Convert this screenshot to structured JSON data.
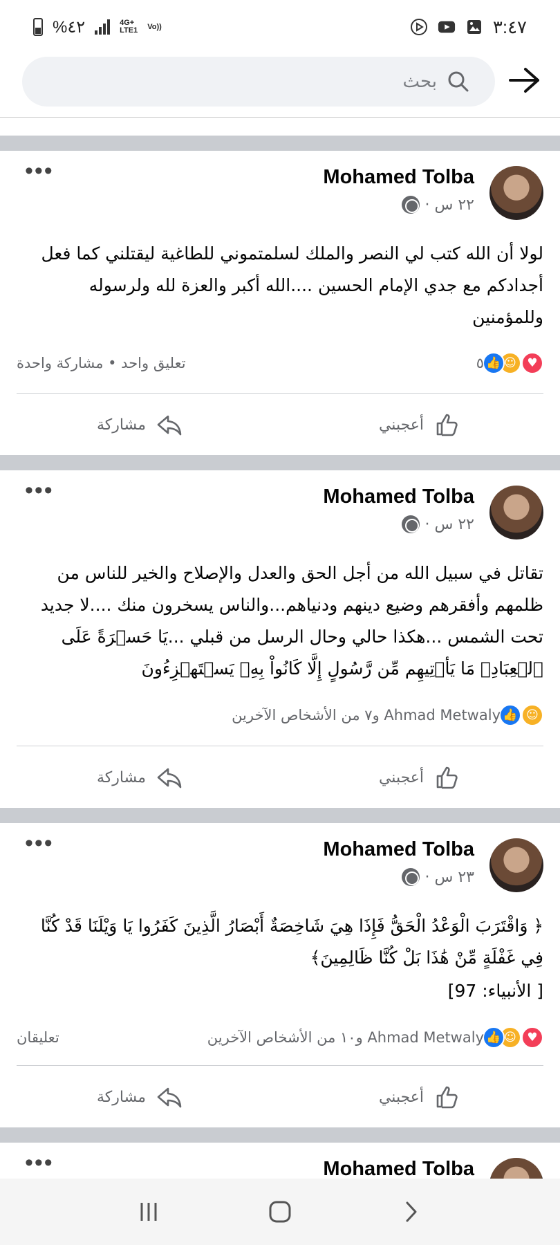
{
  "status_bar": {
    "time": "٣:٤٧",
    "battery": "%٤٢",
    "network_top": "4G+",
    "network_bottom": "LTE1",
    "volte": "Vo))"
  },
  "search": {
    "placeholder": "بحث"
  },
  "posts": [
    {
      "author": "Mohamed Tolba",
      "time": "٢٢ س ·",
      "text": "لولا أن الله كتب لي النصر والملك لسلمتموني للطاغية ليقتلني كما فعل أجدادكم مع جدي الإمام الحسين ....الله أكبر والعزة لله ولرسوله وللمؤمنين",
      "reaction_count": "٥",
      "engagement": "تعليق واحد • مشاركة واحدة",
      "like_label": "أعجبني",
      "share_label": "مشاركة"
    },
    {
      "author": "Mohamed Tolba",
      "time": "٢٢ س ·",
      "text": "تقاتل في سبيل الله من أجل الحق والعدل  والإصلاح والخير للناس من ظلمهم وأفقرهم وضيع دينهم ودنياهم...والناس يسخرون منك ....لا جديد تحت الشمس ...هكذا حالي وحال الرسل من قبلي ...يَا حَسۡرَةً عَلَى ٱلۡعِبَادِۚ مَا يَأۡتِيهِم مِّن رَّسُولٍ إِلَّا كَانُواْ بِهِۦ يَسۡتَهۡزِءُونَ",
      "reaction_summary": "Ahmad Metwaly و٧ من الأشخاص الآخرين",
      "engagement": "",
      "like_label": "أعجبني",
      "share_label": "مشاركة"
    },
    {
      "author": "Mohamed Tolba",
      "time": "٢٣ س ·",
      "text": "﴿ وَاقْتَرَبَ الْوَعْدُ الْحَقُّ فَإِذَا هِيَ شَاخِصَةٌ أَبْصَارُ الَّذِينَ كَفَرُوا يَا وَيْلَنَا قَدْ كُنَّا فِي غَفْلَةٍ مِّنْ هَٰذَا بَلْ كُنَّا ظَالِمِينَ﴾",
      "text2": "[ الأنبياء: 97]",
      "reaction_summary": "Ahmad Metwaly و١٠ من الأشخاص الآخرين",
      "engagement": "تعليقان",
      "like_label": "أعجبني",
      "share_label": "مشاركة"
    },
    {
      "author": "Mohamed Tolba"
    }
  ],
  "icons": {
    "back": "back-arrow-icon",
    "search": "search-icon",
    "more": "more-dots-icon",
    "globe": "globe-icon",
    "like": "thumbs-up-icon",
    "share": "share-arrow-icon"
  },
  "colors": {
    "like_blue": "#1877f2",
    "love_red": "#f33e58",
    "care_yellow": "#f7b125",
    "divider": "#c9ccd1",
    "secondary_text": "#65676b"
  }
}
